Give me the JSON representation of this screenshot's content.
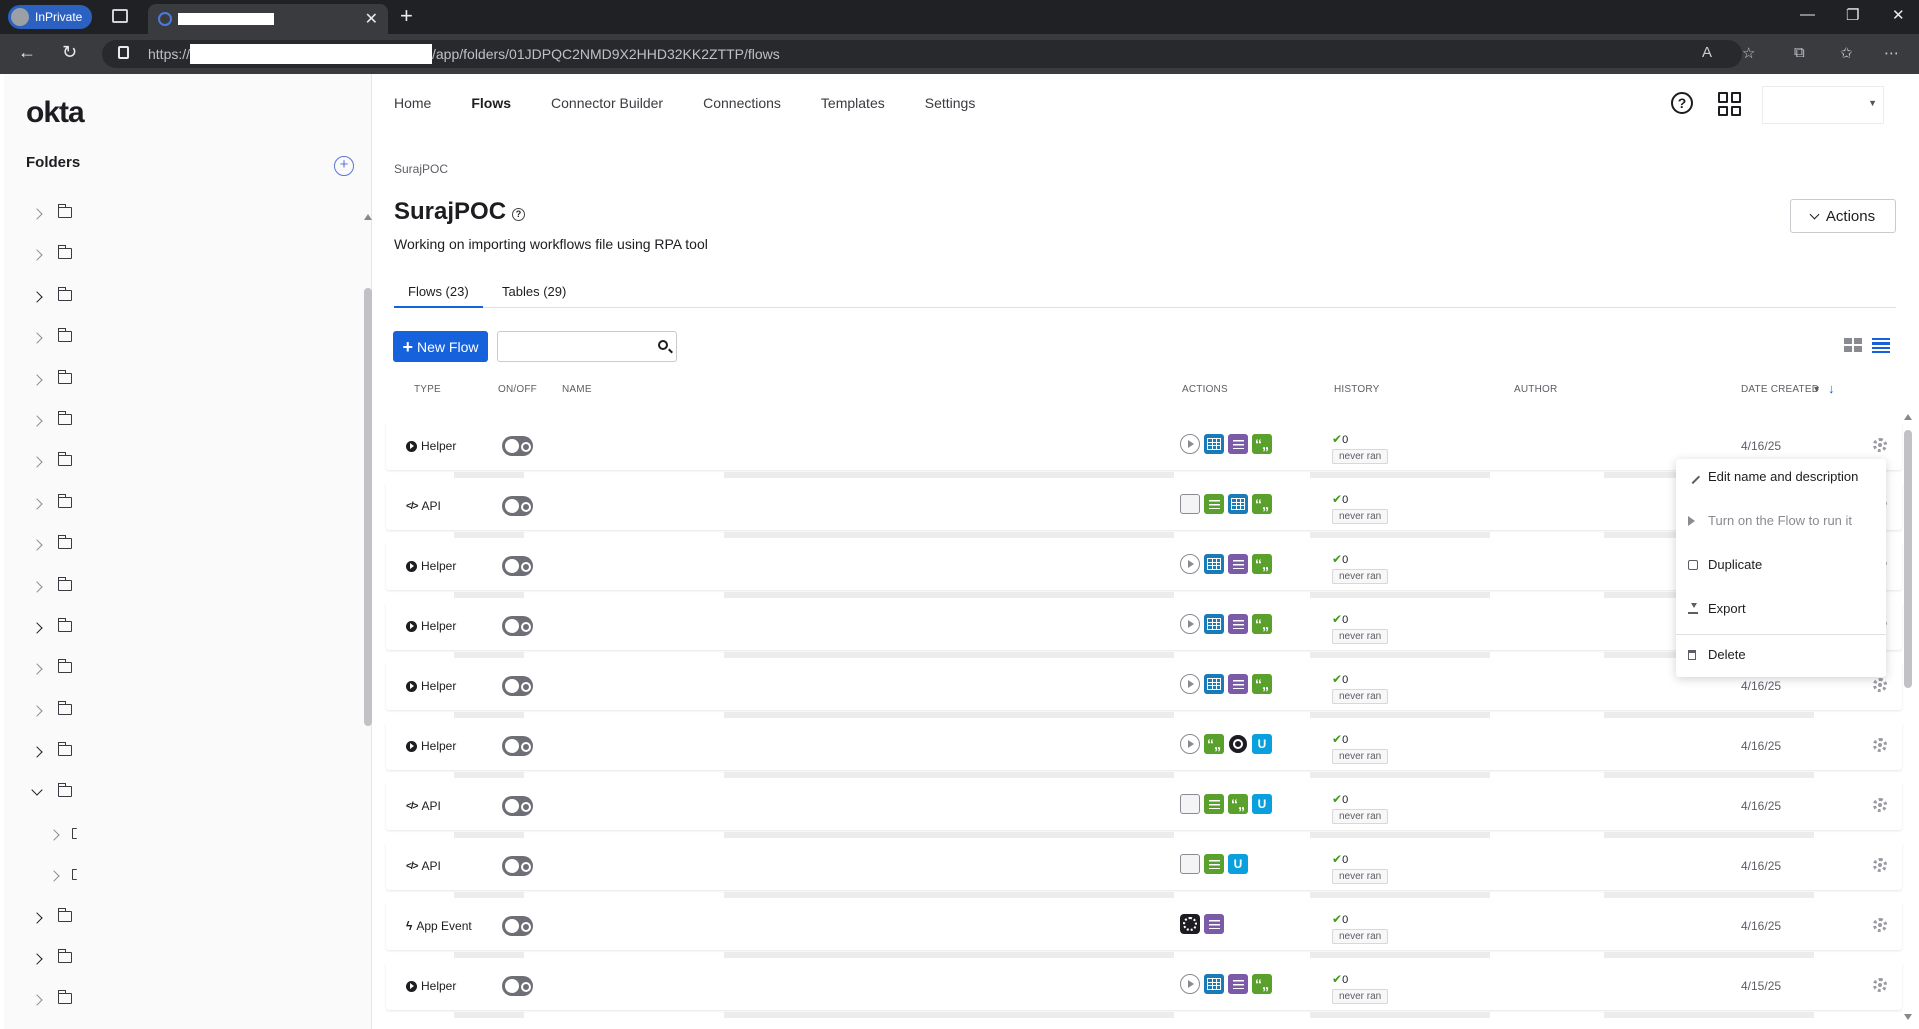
{
  "browser": {
    "inprivate_label": "InPrivate",
    "url_protocol": "https://",
    "url_path": "/app/folders/01JDPQC2NMD9X2HHD32KK2ZTTP/flows"
  },
  "app": {
    "logo": "okta"
  },
  "sidebar": {
    "title": "Folders",
    "add_label": "+",
    "folders": [
      {
        "chevron": "collapsed-light"
      },
      {
        "chevron": "collapsed-light"
      },
      {
        "chevron": "collapsed-dark"
      },
      {
        "chevron": "collapsed-light"
      },
      {
        "chevron": "collapsed-light"
      },
      {
        "chevron": "collapsed-light"
      },
      {
        "chevron": "collapsed-light"
      },
      {
        "chevron": "collapsed-light"
      },
      {
        "chevron": "collapsed-light"
      },
      {
        "chevron": "collapsed-light"
      },
      {
        "chevron": "collapsed-dark"
      },
      {
        "chevron": "collapsed-light"
      },
      {
        "chevron": "collapsed-light"
      },
      {
        "chevron": "collapsed-dark"
      },
      {
        "chevron": "expanded"
      },
      {
        "chevron": "child"
      },
      {
        "chevron": "child"
      },
      {
        "chevron": "collapsed-dark"
      },
      {
        "chevron": "collapsed-dark"
      },
      {
        "chevron": "collapsed-light"
      }
    ]
  },
  "topnav": {
    "items": [
      "Home",
      "Flows",
      "Connector Builder",
      "Connections",
      "Templates",
      "Settings"
    ],
    "active": "Flows"
  },
  "header": {
    "breadcrumb": "SurajPOC",
    "title": "SurajPOC",
    "description": "Working on importing workflows file using RPA tool",
    "actions_label": "Actions",
    "help_glyph": "?"
  },
  "tabs": {
    "flows": "Flows (23)",
    "tables": "Tables (29)"
  },
  "toolbar": {
    "new_flow_label": "New Flow",
    "new_flow_plus": "+",
    "search_placeholder": ""
  },
  "table": {
    "columns": {
      "type": "TYPE",
      "onoff": "ON/OFF",
      "name": "NAME",
      "actions": "ACTIONS",
      "history": "HISTORY",
      "author": "AUTHOR",
      "date": "DATE CREATED",
      "sort_glyph": "↓"
    },
    "rows": [
      {
        "type": "Helper",
        "icons": [
          "play-icon",
          "table-icon",
          "list-icon",
          "text-icon"
        ],
        "ok_count": "0",
        "status": "never ran",
        "date": "4/16/25"
      },
      {
        "type": "API",
        "icons": [
          "api-icon",
          "control-icon",
          "table-icon",
          "text-icon"
        ],
        "ok_count": "0",
        "status": "never ran",
        "date": ""
      },
      {
        "type": "Helper",
        "icons": [
          "play-icon",
          "table-icon",
          "list-icon",
          "text-icon"
        ],
        "ok_count": "0",
        "status": "never ran",
        "date": ""
      },
      {
        "type": "Helper",
        "icons": [
          "play-icon",
          "table-icon",
          "list-icon",
          "text-icon"
        ],
        "ok_count": "0",
        "status": "never ran",
        "date": ""
      },
      {
        "type": "Helper",
        "icons": [
          "play-icon",
          "table-icon",
          "list-icon",
          "text-icon"
        ],
        "ok_count": "0",
        "status": "never ran",
        "date": "4/16/25"
      },
      {
        "type": "Helper",
        "icons": [
          "play-icon",
          "text-icon",
          "github-icon",
          "u-icon"
        ],
        "ok_count": "0",
        "status": "never ran",
        "date": "4/16/25"
      },
      {
        "type": "API",
        "icons": [
          "api-icon",
          "control-icon",
          "text-icon",
          "u-icon"
        ],
        "ok_count": "0",
        "status": "never ran",
        "date": "4/16/25"
      },
      {
        "type": "API",
        "icons": [
          "api-icon",
          "control-icon",
          "u-icon"
        ],
        "ok_count": "0",
        "status": "never ran",
        "date": "4/16/25"
      },
      {
        "type": "App Event",
        "icons": [
          "gear-app-icon",
          "list-icon"
        ],
        "ok_count": "0",
        "status": "never ran",
        "date": "4/16/25"
      },
      {
        "type": "Helper",
        "icons": [
          "play-icon",
          "table-icon",
          "list-icon",
          "text-icon"
        ],
        "ok_count": "0",
        "status": "never ran",
        "date": "4/15/25"
      }
    ]
  },
  "context_menu": {
    "items": [
      {
        "label": "Edit name and description",
        "disabled": false
      },
      {
        "label": "Turn on the Flow to run it",
        "disabled": true
      },
      {
        "label": "Duplicate",
        "disabled": false
      },
      {
        "label": "Export",
        "disabled": false
      },
      {
        "label": "Delete",
        "disabled": false
      }
    ]
  }
}
